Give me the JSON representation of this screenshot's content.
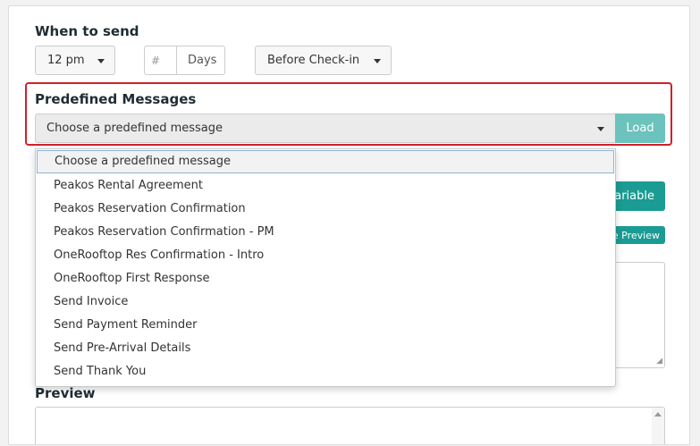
{
  "when_to_send": {
    "heading": "When to send",
    "time_value": "12 pm",
    "number_placeholder": "#",
    "days_label": "Days",
    "relation_value": "Before Check-in"
  },
  "predefined": {
    "heading": "Predefined Messages",
    "selected": "Choose a predefined message",
    "load_label": "Load",
    "options": [
      "Choose a predefined message",
      "Peakos Rental Agreement",
      "Peakos Reservation Confirmation",
      "Peakos Reservation Confirmation - PM",
      "OneRooftop Res Confirmation - Intro",
      "OneRooftop First Response",
      "Send Invoice",
      "Send Payment Reminder",
      "Send Pre-Arrival Details",
      "Send Thank You"
    ]
  },
  "partial_buttons": {
    "variable_label": "Variable",
    "preview_label": "e Preview"
  },
  "preview": {
    "heading": "Preview"
  },
  "colors": {
    "accent": "#1a9b93",
    "load_button": "#6cc2bc",
    "highlight": "#d0202c"
  }
}
